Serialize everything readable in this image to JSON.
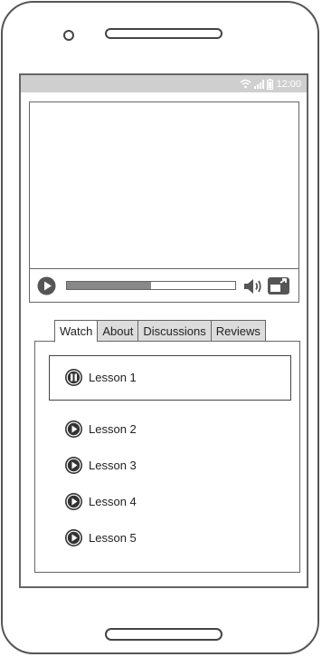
{
  "status_bar": {
    "time": "12:00"
  },
  "video": {
    "progress_fraction": 0.5
  },
  "tabs": [
    {
      "label": "Watch",
      "active": true
    },
    {
      "label": "About",
      "active": false
    },
    {
      "label": "Discussions",
      "active": false
    },
    {
      "label": "Reviews",
      "active": false
    }
  ],
  "lessons": [
    {
      "label": "Lesson 1",
      "state": "playing"
    },
    {
      "label": "Lesson 2",
      "state": "idle"
    },
    {
      "label": "Lesson 3",
      "state": "idle"
    },
    {
      "label": "Lesson 4",
      "state": "idle"
    },
    {
      "label": "Lesson 5",
      "state": "idle"
    }
  ],
  "icons": {
    "wifi": "wifi-icon",
    "signal": "signal-icon",
    "battery": "battery-icon",
    "play": "play-icon",
    "pause": "pause-icon",
    "volume": "volume-icon",
    "fullscreen": "fullscreen-icon"
  }
}
